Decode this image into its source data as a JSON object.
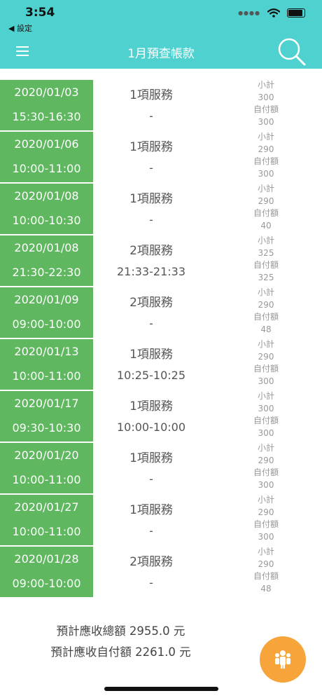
{
  "status": {
    "time": "3:54",
    "back": "◀ 設定"
  },
  "header": {
    "title": "1月預查帳款"
  },
  "labels": {
    "subtotal": "小計",
    "copay": "自付額"
  },
  "rows": [
    {
      "date": "2020/01/03",
      "time": "15:30-16:30",
      "services": "1項服務",
      "actual": "-",
      "subtotal": "300",
      "copay": "300"
    },
    {
      "date": "2020/01/06",
      "time": "10:00-11:00",
      "services": "1項服務",
      "actual": "-",
      "subtotal": "290",
      "copay": "300"
    },
    {
      "date": "2020/01/08",
      "time": "10:00-10:30",
      "services": "1項服務",
      "actual": "-",
      "subtotal": "290",
      "copay": "40"
    },
    {
      "date": "2020/01/08",
      "time": "21:30-22:30",
      "services": "2項服務",
      "actual": "21:33-21:33",
      "subtotal": "325",
      "copay": "325"
    },
    {
      "date": "2020/01/09",
      "time": "09:00-10:00",
      "services": "2項服務",
      "actual": "-",
      "subtotal": "290",
      "copay": "48"
    },
    {
      "date": "2020/01/13",
      "time": "10:00-11:00",
      "services": "1項服務",
      "actual": "10:25-10:25",
      "subtotal": "290",
      "copay": "300"
    },
    {
      "date": "2020/01/17",
      "time": "09:30-10:30",
      "services": "1項服務",
      "actual": "10:00-10:00",
      "subtotal": "300",
      "copay": "300"
    },
    {
      "date": "2020/01/20",
      "time": "10:00-11:00",
      "services": "1項服務",
      "actual": "-",
      "subtotal": "290",
      "copay": "300"
    },
    {
      "date": "2020/01/27",
      "time": "10:00-11:00",
      "services": "1項服務",
      "actual": "-",
      "subtotal": "290",
      "copay": "300"
    },
    {
      "date": "2020/01/28",
      "time": "09:00-10:00",
      "services": "2項服務",
      "actual": "-",
      "subtotal": "290",
      "copay": "48"
    }
  ],
  "totals": {
    "receivable": "預計應收總額 2955.0 元",
    "copay": "預計應收自付額 2261.0 元"
  },
  "colors": {
    "header": "#4fd1d0",
    "date_bg": "#5fb85f",
    "fab": "#f7a43a"
  }
}
